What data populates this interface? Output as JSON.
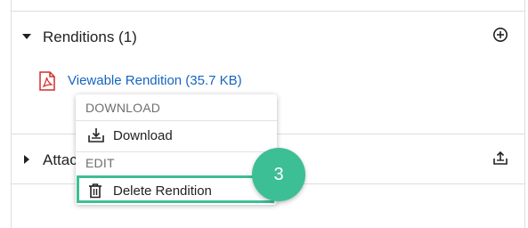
{
  "renditions_section": {
    "title": "Renditions (1)",
    "add_icon": "plus-circle-icon",
    "items": [
      {
        "icon": "pdf-icon",
        "label": "Viewable Rendition (35.7 KB)"
      }
    ]
  },
  "attachments_section": {
    "title_visible": "Attac",
    "upload_icon": "upload-tray-icon"
  },
  "context_menu": {
    "download_heading": "DOWNLOAD",
    "download_label": "Download",
    "download_icon": "download-tray-icon",
    "edit_heading": "EDIT",
    "delete_label": "Delete Rendition",
    "delete_icon": "trash-icon"
  },
  "callout": {
    "step_number": "3",
    "color": "#3dbf95"
  },
  "colors": {
    "link": "#1565c0",
    "pdf_red": "#d32f2f"
  }
}
